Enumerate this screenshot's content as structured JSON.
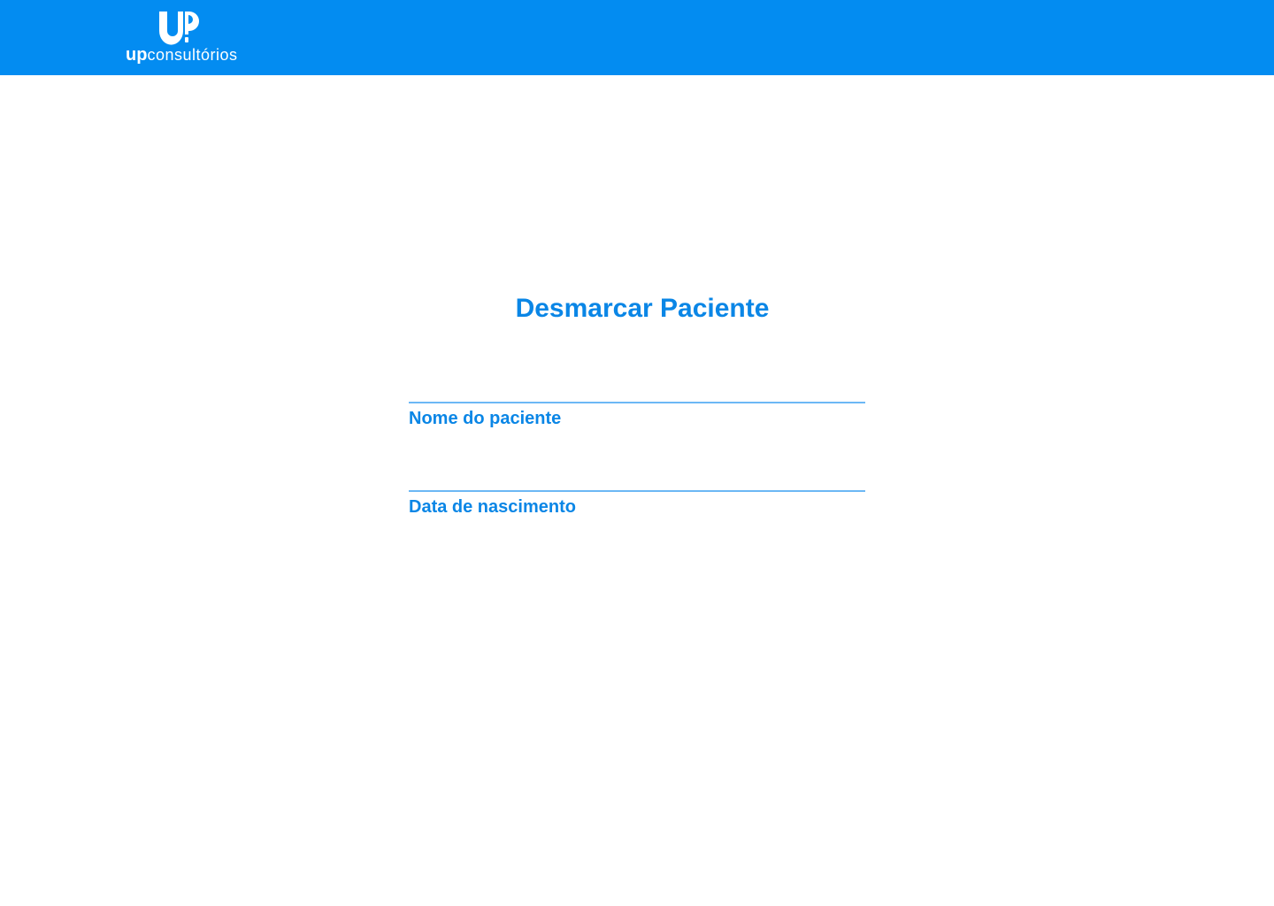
{
  "header": {
    "logo": {
      "mark_icon": "up-logo-mark-icon",
      "brand_bold": "up",
      "brand_rest": "consultórios"
    }
  },
  "main": {
    "title": "Desmarcar Paciente",
    "fields": {
      "patient_name": {
        "label": "Nome do paciente",
        "value": ""
      },
      "birth_date": {
        "label": "Data de nascimento",
        "value": ""
      }
    }
  },
  "colors": {
    "header_bg": "#038cf1",
    "accent_text": "#0a86e6",
    "input_underline": "#6cb8f5",
    "background": "#ffffff"
  }
}
